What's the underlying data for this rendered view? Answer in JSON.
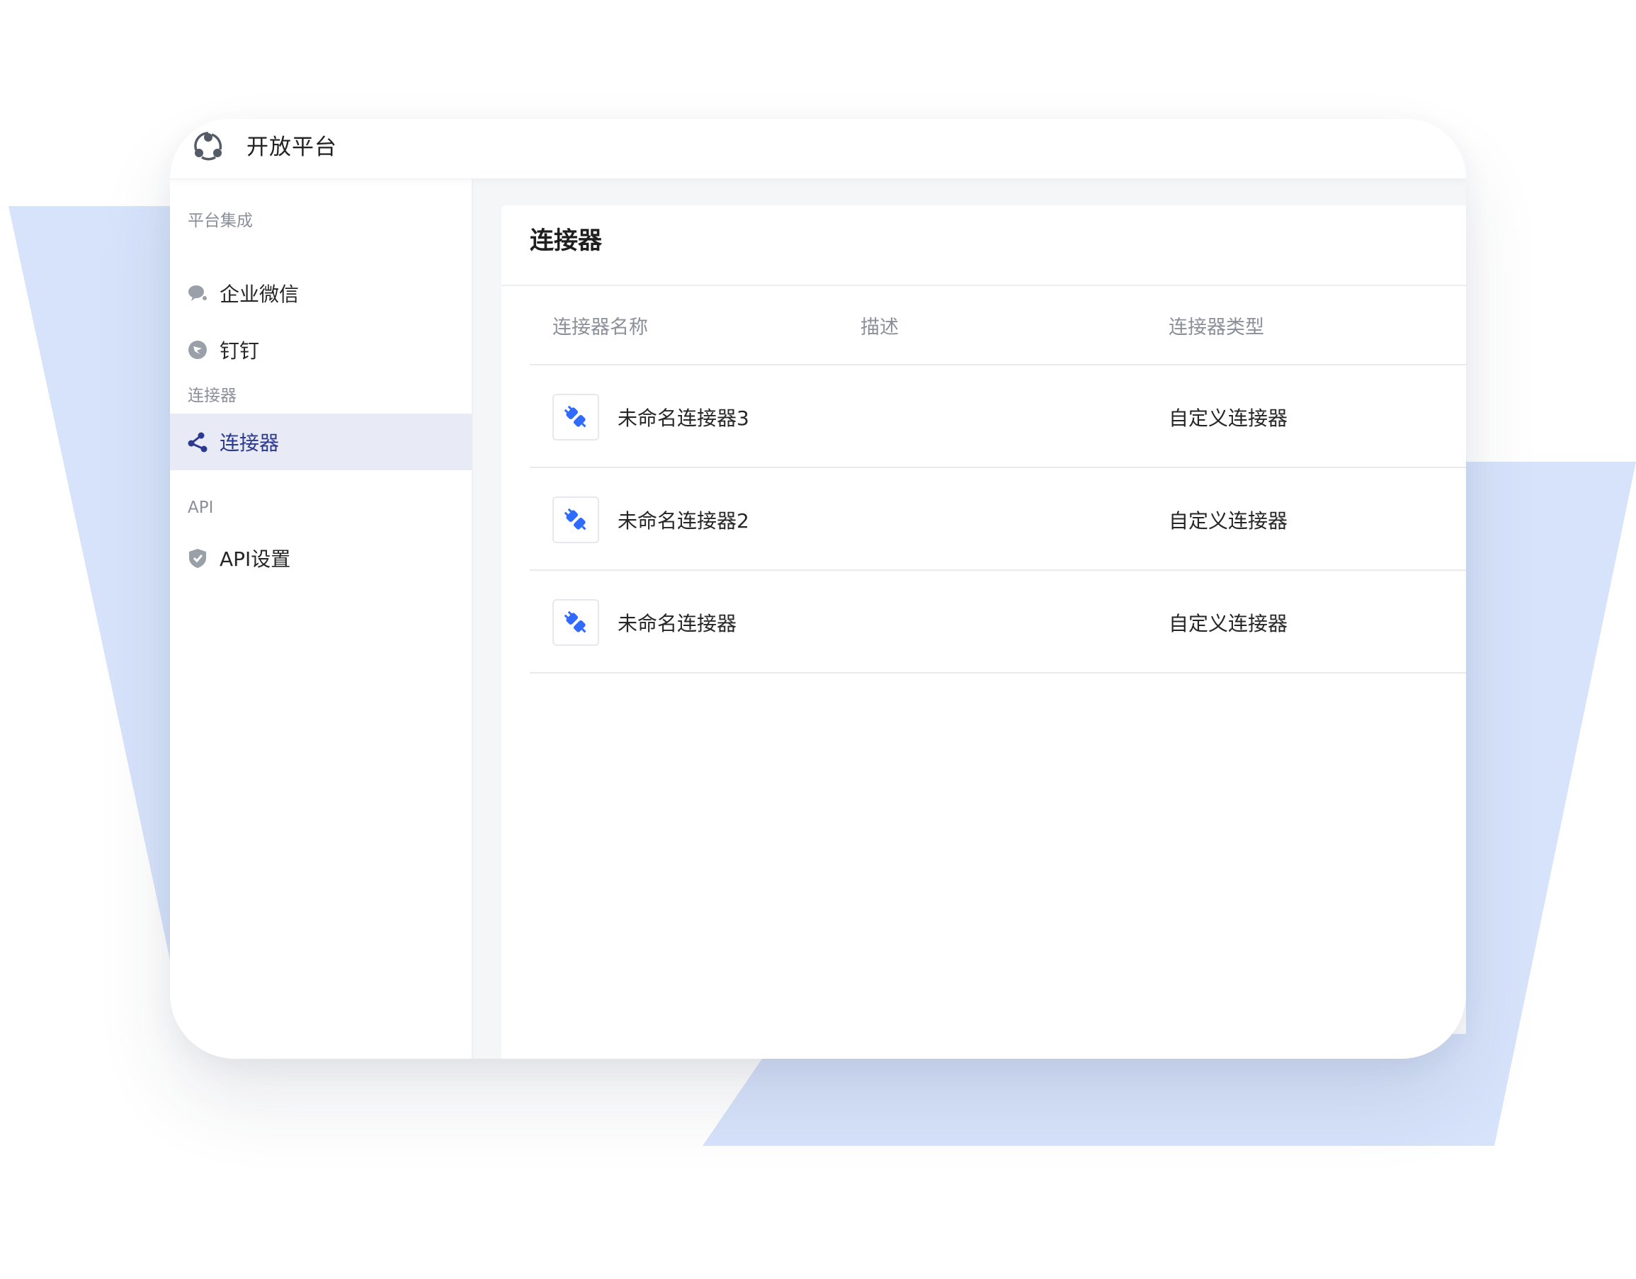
{
  "app": {
    "title": "开放平台"
  },
  "sidebar": {
    "groups": [
      {
        "title": "平台集成",
        "items": [
          {
            "label": "企业微信",
            "icon": "wechat-work-icon"
          },
          {
            "label": "钉钉",
            "icon": "dingtalk-icon"
          }
        ]
      },
      {
        "title": "连接器",
        "items": [
          {
            "label": "连接器",
            "icon": "connector-network-icon",
            "active": true
          }
        ]
      },
      {
        "title": "API",
        "items": [
          {
            "label": "API设置",
            "icon": "shield-icon"
          }
        ]
      }
    ]
  },
  "main": {
    "title": "连接器",
    "table": {
      "columns": [
        "连接器名称",
        "描述",
        "连接器类型"
      ],
      "rows": [
        {
          "name": "未命名连接器3",
          "description": "",
          "type": "自定义连接器",
          "icon": "plug-icon"
        },
        {
          "name": "未命名连接器2",
          "description": "",
          "type": "自定义连接器",
          "icon": "plug-icon"
        },
        {
          "name": "未命名连接器",
          "description": "",
          "type": "自定义连接器",
          "icon": "plug-icon"
        }
      ]
    }
  },
  "colors": {
    "accent": "#2f6bff",
    "active_bg": "#e8eaf6",
    "active_text": "#2b3a8f",
    "background_shape": "#d7e3fb",
    "icon_gray": "#9aa0a8"
  }
}
